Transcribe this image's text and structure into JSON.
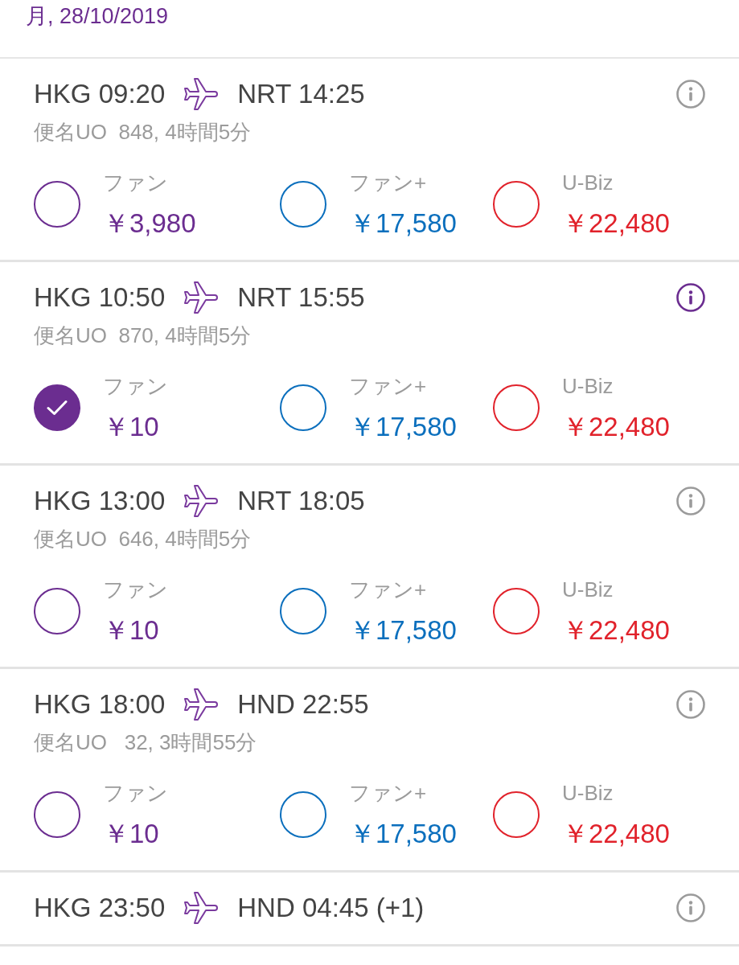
{
  "date": "月, 28/10/2019",
  "flights": [
    {
      "origin": "HKG 09:20",
      "destination": "NRT 14:25",
      "info_active": false,
      "details": "便名UO  848, 4時間5分",
      "fares": [
        {
          "name": "ファン",
          "price": "￥3,980",
          "color": "#6b2d90",
          "selected": false
        },
        {
          "name": "ファン+",
          "price": "￥17,580",
          "color": "#0b6fbd",
          "selected": false
        },
        {
          "name": "U-Biz",
          "price": "￥22,480",
          "color": "#e1222b",
          "selected": false
        }
      ]
    },
    {
      "origin": "HKG 10:50",
      "destination": "NRT 15:55",
      "info_active": true,
      "details": "便名UO  870, 4時間5分",
      "fares": [
        {
          "name": "ファン",
          "price": "￥10",
          "color": "#6b2d90",
          "selected": true
        },
        {
          "name": "ファン+",
          "price": "￥17,580",
          "color": "#0b6fbd",
          "selected": false
        },
        {
          "name": "U-Biz",
          "price": "￥22,480",
          "color": "#e1222b",
          "selected": false
        }
      ]
    },
    {
      "origin": "HKG 13:00",
      "destination": "NRT 18:05",
      "info_active": false,
      "details": "便名UO  646, 4時間5分",
      "fares": [
        {
          "name": "ファン",
          "price": "￥10",
          "color": "#6b2d90",
          "selected": false
        },
        {
          "name": "ファン+",
          "price": "￥17,580",
          "color": "#0b6fbd",
          "selected": false
        },
        {
          "name": "U-Biz",
          "price": "￥22,480",
          "color": "#e1222b",
          "selected": false
        }
      ]
    },
    {
      "origin": "HKG 18:00",
      "destination": "HND 22:55",
      "info_active": false,
      "details": "便名UO   32, 3時間55分",
      "fares": [
        {
          "name": "ファン",
          "price": "￥10",
          "color": "#6b2d90",
          "selected": false
        },
        {
          "name": "ファン+",
          "price": "￥17,580",
          "color": "#0b6fbd",
          "selected": false
        },
        {
          "name": "U-Biz",
          "price": "￥22,480",
          "color": "#e1222b",
          "selected": false
        }
      ]
    },
    {
      "origin": "HKG 23:50",
      "destination": "HND 04:45 (+1)",
      "info_active": false
    }
  ]
}
